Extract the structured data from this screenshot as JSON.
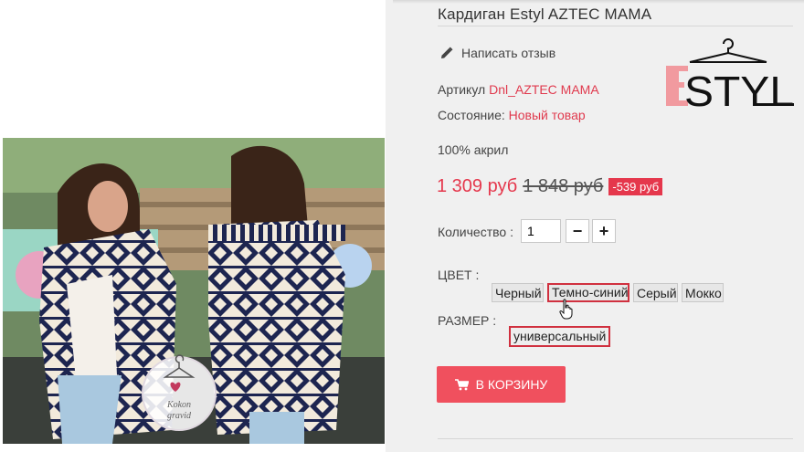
{
  "product": {
    "title": "Кардиган Estyl AZTEC MAMA",
    "review_link": "Написать отзыв",
    "sku_label": "Артикул",
    "sku_value": "Dnl_AZTEC MAMA",
    "condition_label": "Состояние:",
    "condition_value": "Новый товар",
    "material": "100% акрил",
    "price": "1 309 руб",
    "old_price": "1 848 руб",
    "discount": "-539 руб",
    "quantity_label": "Количество :",
    "quantity_value": "1",
    "minus": "−",
    "plus": "+",
    "color_label": "ЦВЕТ :",
    "colors": [
      "Черный",
      "Темно-синий",
      "Серый",
      "Мокко"
    ],
    "selected_color": "Темно-синий",
    "size_label": "РАЗМЕР :",
    "sizes": [
      "универсальный"
    ],
    "cart_button": "В КОРЗИНУ"
  },
  "brand": {
    "logo_text": "ESTYL"
  },
  "watermark": {
    "text": "Kokon gravid"
  },
  "colors": {
    "accent": "#e5374c",
    "button": "#f0505e",
    "selected_border": "#d0303f"
  },
  "icons": [
    "pencil-icon",
    "cart-icon",
    "hand-cursor-icon",
    "hanger-icon"
  ]
}
